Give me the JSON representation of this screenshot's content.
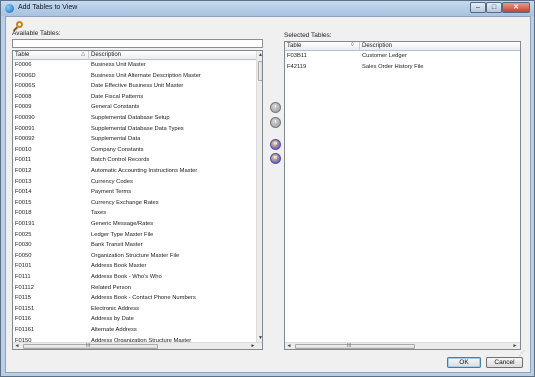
{
  "window": {
    "title": "Add Tables to View",
    "controls": {
      "minimize": "–",
      "maximize": "□",
      "close": "✕"
    }
  },
  "toolbar": {
    "icon": "search-magnifier-icon"
  },
  "available": {
    "label": "Available Tables:",
    "filter_value": "",
    "headers": {
      "table": "Table",
      "sort_glyph": "△",
      "description": "Description"
    },
    "rows": [
      {
        "table": "F0006",
        "description": "Business Unit Master"
      },
      {
        "table": "F0006D",
        "description": "Business Unit Alternate Description Master"
      },
      {
        "table": "F0006S",
        "description": "Date Effective Business Unit Master"
      },
      {
        "table": "F0008",
        "description": "Date Fiscal Patterns"
      },
      {
        "table": "F0009",
        "description": "General Constants"
      },
      {
        "table": "F00090",
        "description": "Supplemental Database Setup"
      },
      {
        "table": "F00091",
        "description": "Supplemental Database Data Types"
      },
      {
        "table": "F00092",
        "description": "Supplemental Data"
      },
      {
        "table": "F0010",
        "description": "Company Constants"
      },
      {
        "table": "F0011",
        "description": "Batch Control Records"
      },
      {
        "table": "F0012",
        "description": "Automatic Accounting Instructions Master"
      },
      {
        "table": "F0013",
        "description": "Currency Codes"
      },
      {
        "table": "F0014",
        "description": "Payment Terms"
      },
      {
        "table": "F0015",
        "description": "Currency Exchange Rates"
      },
      {
        "table": "F0018",
        "description": "Taxes"
      },
      {
        "table": "F00191",
        "description": "Generic Message/Rates"
      },
      {
        "table": "F0025",
        "description": "Ledger Type Master File"
      },
      {
        "table": "F0030",
        "description": "Bank Transit Master"
      },
      {
        "table": "F0050",
        "description": "Organization Structure Master File"
      },
      {
        "table": "F0101",
        "description": "Address Book Master"
      },
      {
        "table": "F0111",
        "description": "Address Book - Who's Who"
      },
      {
        "table": "F01112",
        "description": "Related Person"
      },
      {
        "table": "F0115",
        "description": "Address Book - Contact Phone Numbers"
      },
      {
        "table": "F01151",
        "description": "Electronic Address"
      },
      {
        "table": "F0116",
        "description": "Address by Date"
      },
      {
        "table": "F01161",
        "description": "Alternate Address"
      },
      {
        "table": "F0150",
        "description": "Address Organization Structure Master"
      }
    ]
  },
  "selected": {
    "label": "Selected Tables:",
    "headers": {
      "table": "Table",
      "sort_glyph": "◊",
      "description": "Description"
    },
    "rows": [
      {
        "table": "F03B11",
        "description": "Customer Ledger"
      },
      {
        "table": "F42119",
        "description": "Sales Order History File"
      }
    ]
  },
  "move_buttons": {
    "add": "›",
    "remove": "‹",
    "add_all": "»",
    "remove_all": "«"
  },
  "scroll": {
    "up": "▲",
    "down": "▼",
    "left": "◄",
    "right": "►",
    "grip": "III"
  },
  "buttons": {
    "ok": "OK",
    "cancel": "Cancel"
  }
}
